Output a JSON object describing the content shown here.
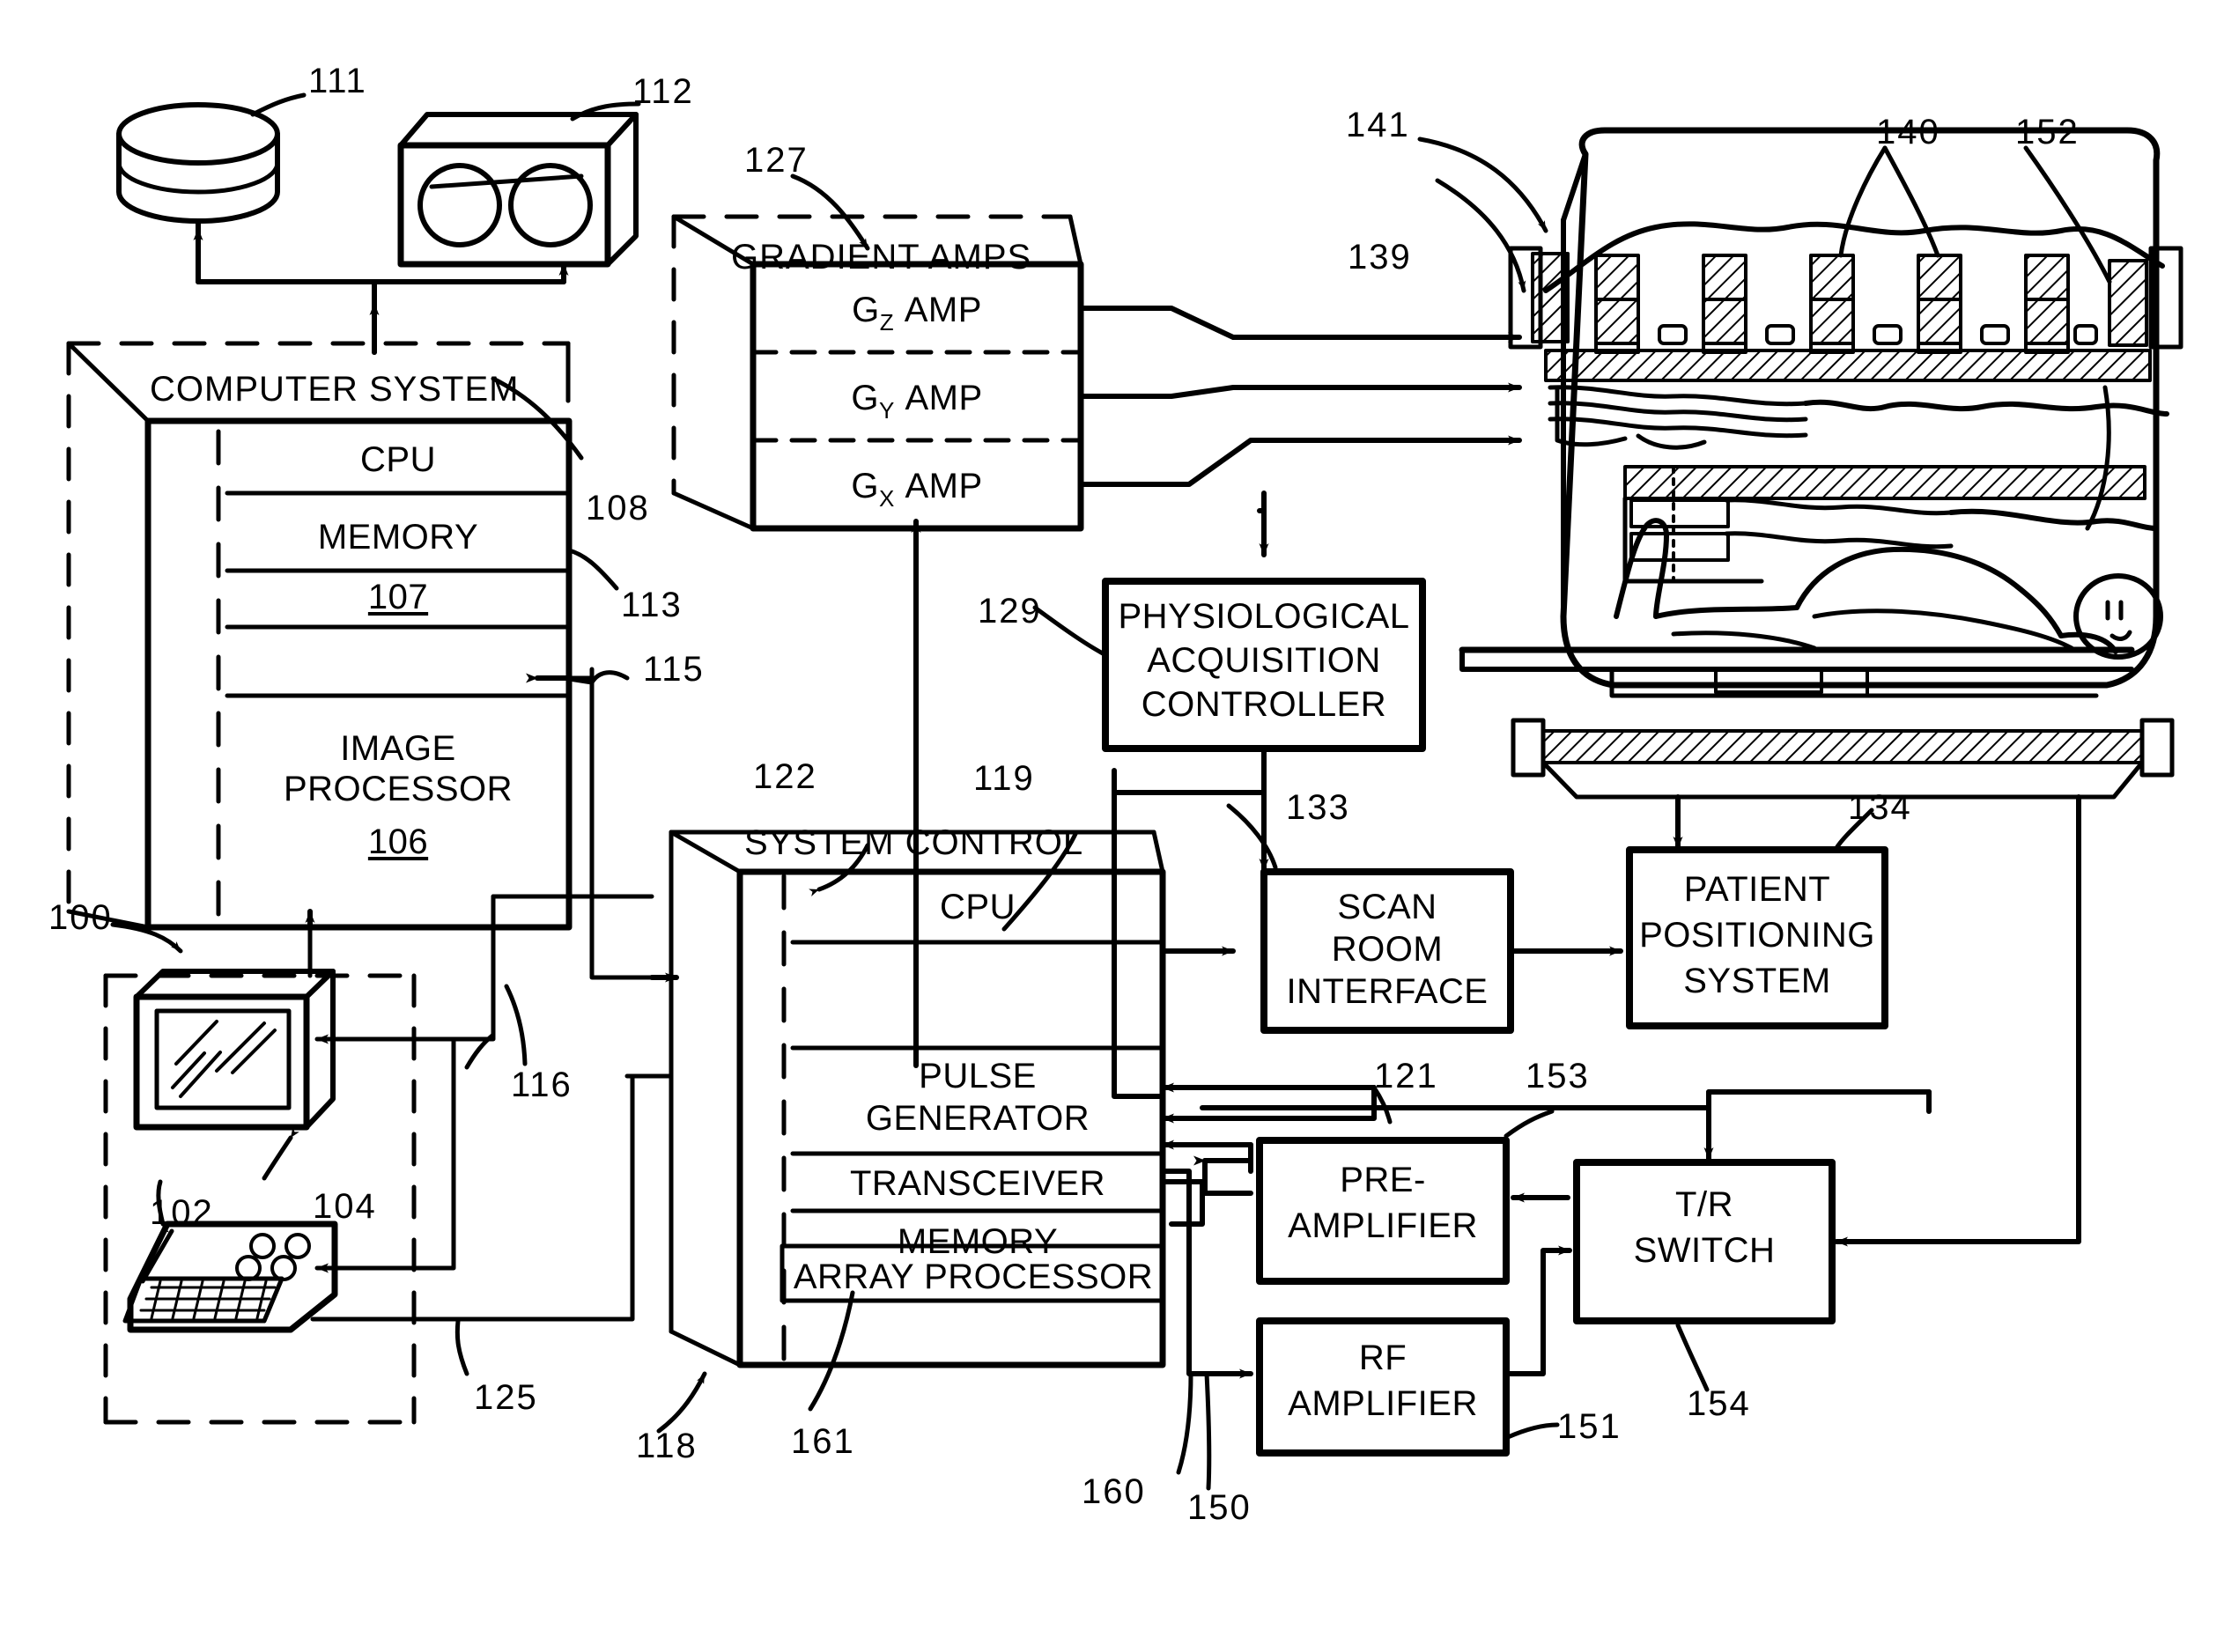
{
  "figure": {
    "kind": "patent-figure",
    "subject": "MRI system block diagram",
    "ink_color": "#000000",
    "background_color": "#ffffff"
  },
  "blocks": {
    "computer_system": {
      "title": "COMPUTER SYSTEM",
      "rows": [
        "CPU",
        "MEMORY",
        "107",
        "IMAGE\nPROCESSOR\n106"
      ],
      "cpu": "CPU",
      "memory": "MEMORY",
      "memory_ref": "107",
      "image_processor_l1": "IMAGE",
      "image_processor_l2": "PROCESSOR",
      "image_processor_ref": "106"
    },
    "gradient_amps": {
      "title": "GRADIENT AMPS",
      "amps": [
        {
          "g": "G",
          "axis": "Z",
          "word": "AMP"
        },
        {
          "g": "G",
          "axis": "Y",
          "word": "AMP"
        },
        {
          "g": "G",
          "axis": "X",
          "word": "AMP"
        }
      ]
    },
    "system_control": {
      "title": "SYSTEM CONTROL",
      "cpu": "CPU",
      "pulse_generator_l1": "PULSE",
      "pulse_generator_l2": "GENERATOR",
      "transceiver": "TRANSCEIVER",
      "memory": "MEMORY",
      "array_processor": "ARRAY PROCESSOR"
    },
    "physiological_acquisition_controller": {
      "l1": "PHYSIOLOGICAL",
      "l2": "ACQUISITION",
      "l3": "CONTROLLER"
    },
    "scan_room_interface": {
      "l1": "SCAN",
      "l2": "ROOM",
      "l3": "INTERFACE"
    },
    "patient_positioning_system": {
      "l1": "PATIENT",
      "l2": "POSITIONING",
      "l3": "SYSTEM"
    },
    "pre_amplifier": {
      "l1": "PRE-",
      "l2": "AMPLIFIER"
    },
    "rf_amplifier": {
      "l1": "RF",
      "l2": "AMPLIFIER"
    },
    "tr_switch": {
      "l1": "T/R",
      "l2": "SWITCH"
    }
  },
  "reference_numerals": {
    "disk_drive": "111",
    "tape_drive": "112",
    "gradient_amps": "127",
    "magnet_assembly": "141",
    "gradient_coils": "140",
    "rf_coil": "152",
    "polarizing_magnet": "139",
    "computer_system": "108",
    "memory": "113",
    "link_115": "115",
    "operator_console": "100",
    "keyboard_control_panel": "102",
    "display": "104",
    "link_116": "116",
    "link_125": "125",
    "system_control": "122",
    "cpu_link": "119",
    "physiological_acquisition_controller": "129",
    "scan_room_interface": "133",
    "patient_positioning_system": "134",
    "pulse_generator_link": "121",
    "preamplifier": "153",
    "tr_switch": "154",
    "rf_amplifier": "151",
    "transceiver_link_160": "160",
    "transceiver_link_150": "150",
    "system_control_ref": "118",
    "array_processor": "161"
  }
}
